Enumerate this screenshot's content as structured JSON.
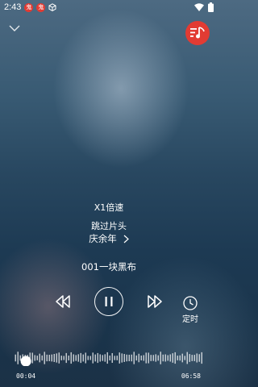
{
  "status_bar": {
    "time": "2:43",
    "badges": [
      "鬼",
      "鬼"
    ],
    "icons": [
      "cube-icon",
      "wifi-icon",
      "battery-icon"
    ]
  },
  "header": {
    "collapse_icon": "chevron-down-icon",
    "logo_icon": "music-app-logo-icon",
    "accent_color": "#e23b33"
  },
  "player": {
    "speed_label": "X1倍速",
    "skip_intro_label": "跳过片头",
    "album_title": "庆余年",
    "track_title": "001一块黑布",
    "timer_label": "定时",
    "controls": [
      "rewind-icon",
      "pause-icon",
      "fast-forward-icon",
      "clock-icon"
    ]
  },
  "progress": {
    "current_time": "00:04",
    "total_time": "06:58",
    "fraction": 0.0096
  }
}
